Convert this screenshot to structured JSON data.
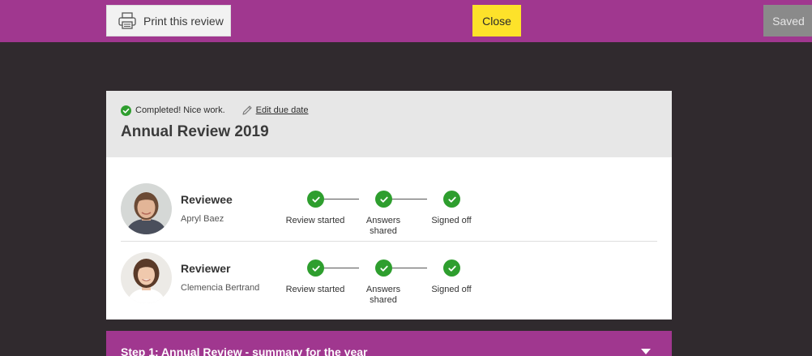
{
  "toolbar": {
    "print_label": "Print this review",
    "close_label": "Close",
    "saved_label": "Saved"
  },
  "review": {
    "status": "Completed! Nice work.",
    "edit_due_date": "Edit due date",
    "title": "Annual Review 2019"
  },
  "participants": [
    {
      "role": "Reviewee",
      "name": "Apryl Baez",
      "steps": [
        "Review started",
        "Answers shared",
        "Signed off"
      ]
    },
    {
      "role": "Reviewer",
      "name": "Clemencia Bertrand",
      "steps": [
        "Review started",
        "Answers shared",
        "Signed off"
      ]
    }
  ],
  "sections": [
    {
      "label": "Step 1: Annual Review - summary for the year"
    }
  ],
  "colors": {
    "brand": "#a0378f",
    "close_button": "#fde22a",
    "complete": "#2e9e2e",
    "background": "#302a2e"
  },
  "icons": [
    "printer-icon",
    "check-circle-icon",
    "pencil-icon",
    "checkmark-icon",
    "chevron-down-icon"
  ]
}
